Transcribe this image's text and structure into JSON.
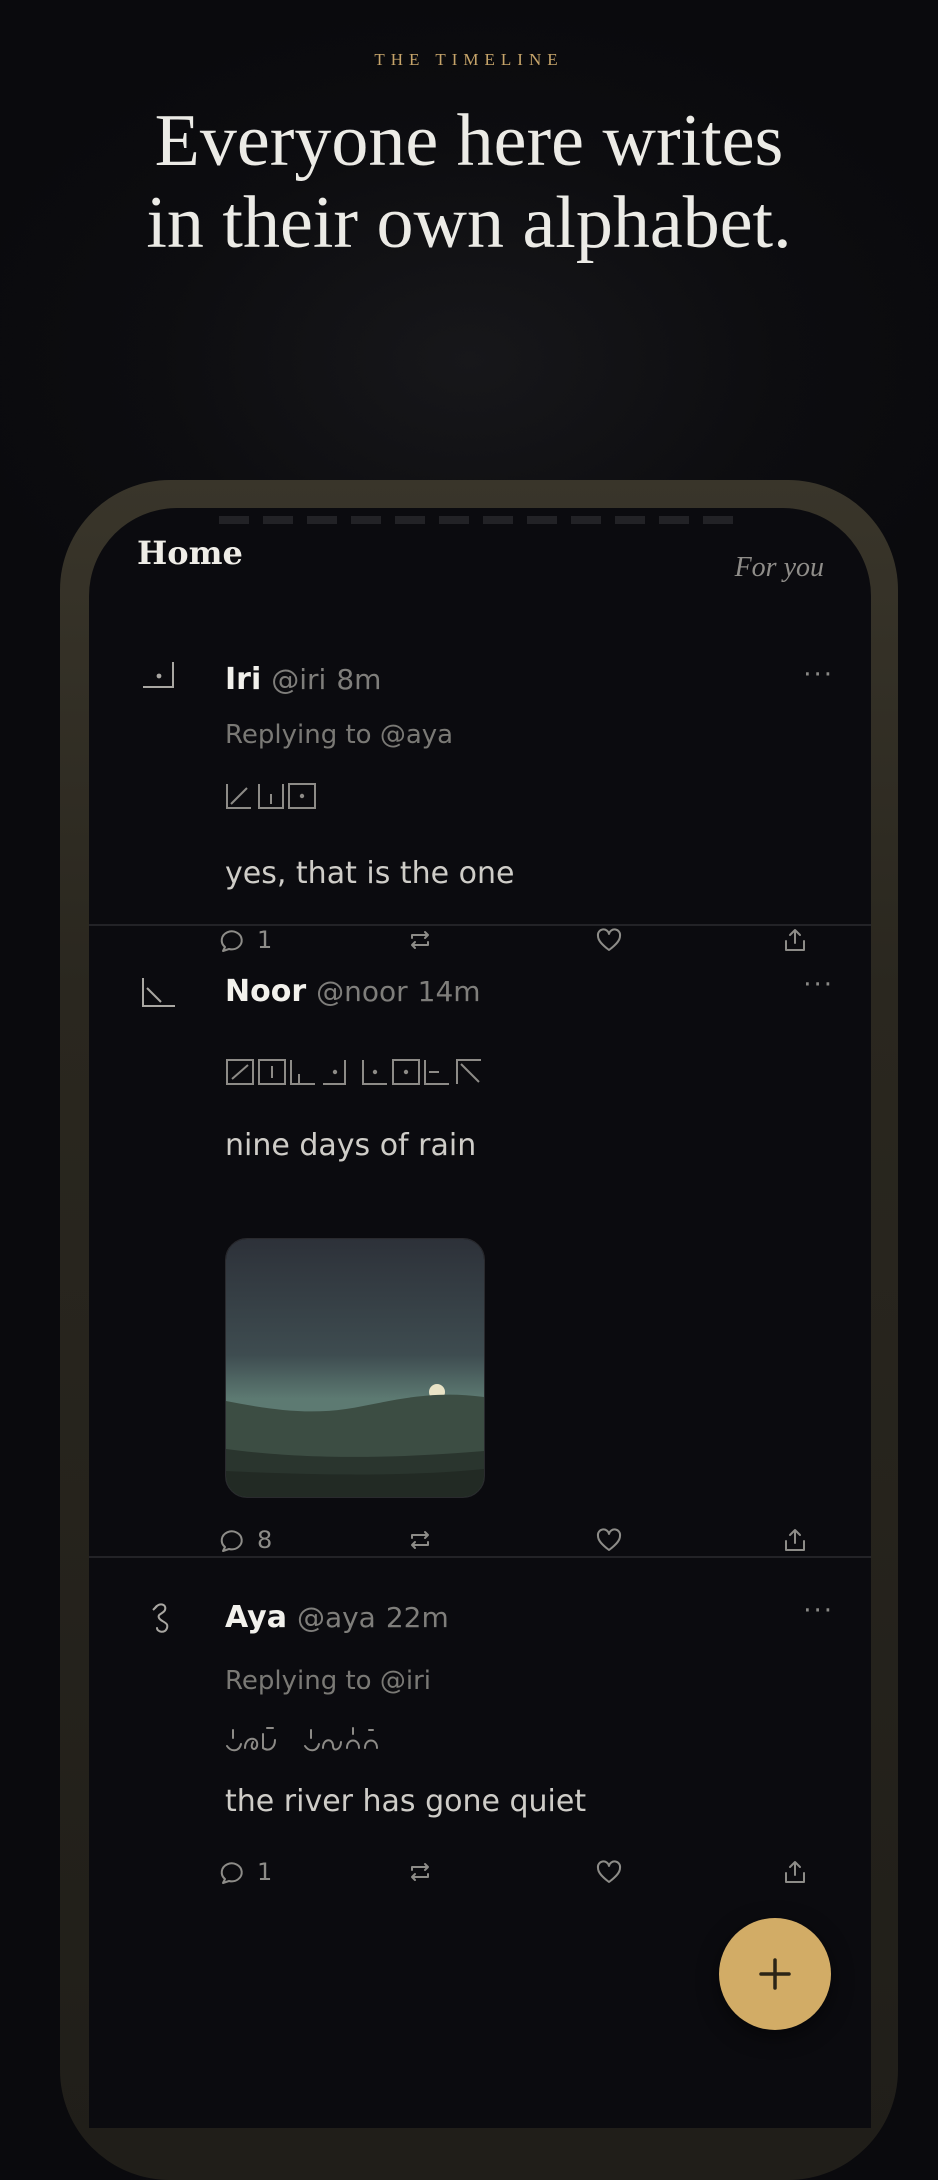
{
  "page": {
    "eyebrow": "THE TIMELINE",
    "headline_line1": "Everyone here writes",
    "headline_line2": "in their own alphabet."
  },
  "app": {
    "title": "Home",
    "feed_tab": "For you",
    "accent_color": "#d2ac66"
  },
  "posts": [
    {
      "name": "Iri",
      "handle": "@iri",
      "time": "8m",
      "replying_to": "Replying to @aya",
      "script_text": "⟀⊥⊡",
      "text": "yes, that is the one",
      "reply_count": "1",
      "has_image": false
    },
    {
      "name": "Noor",
      "handle": "@noor",
      "time": "14m",
      "replying_to": "",
      "script_text": "⊘⊟⊥⊡ ⊡⊡⊢⊼",
      "text": "nine days of rain",
      "reply_count": "8",
      "has_image": true
    },
    {
      "name": "Aya",
      "handle": "@aya",
      "time": "22m",
      "replying_to": "Replying to @iri",
      "script_text": "ᠡᡋᡎ ᠡᠴᡄᡄ",
      "text": "the river has gone quiet",
      "reply_count": "1",
      "has_image": false
    }
  ],
  "actions": {
    "reply_icon": "speech-bubble-icon",
    "repost_icon": "repost-arrows-icon",
    "like_icon": "heart-icon",
    "share_icon": "share-upload-icon",
    "more_icon": "ellipsis-icon",
    "more_label": "···"
  },
  "fab": {
    "label": "+",
    "icon": "plus-icon"
  }
}
